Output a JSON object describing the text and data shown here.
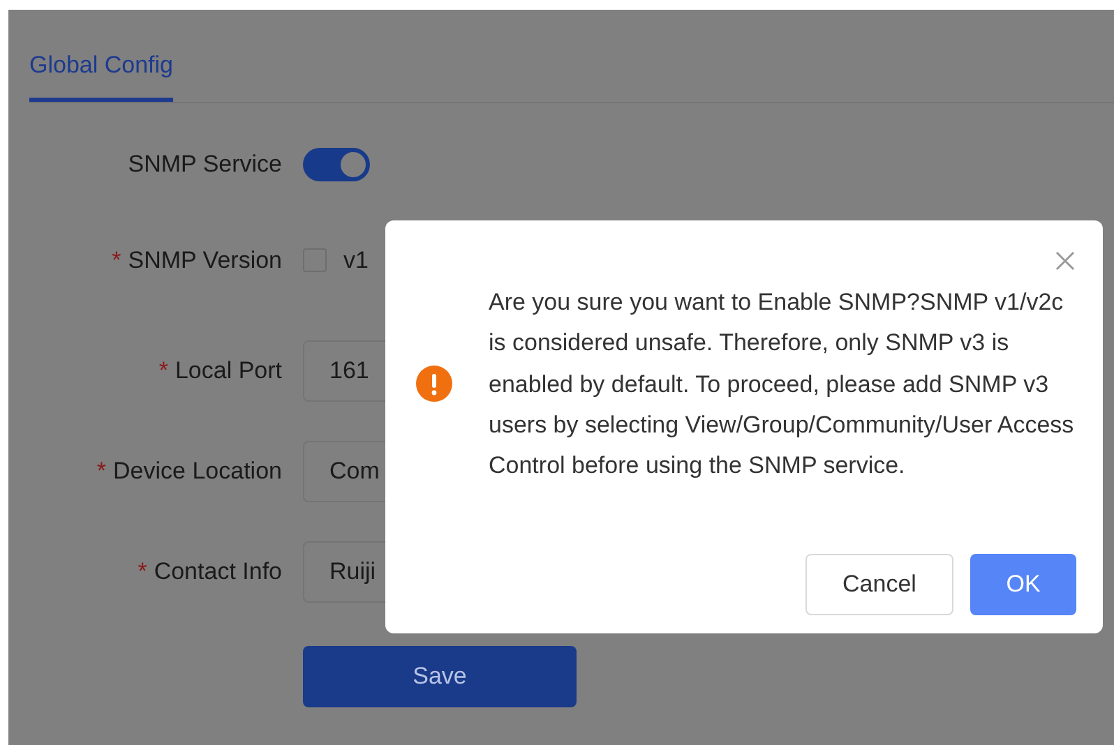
{
  "tabs": [
    {
      "label": "Global Config",
      "selected": true
    }
  ],
  "form": {
    "rows": [
      {
        "kind": "toggle",
        "label": "SNMP Service",
        "required": false,
        "on": true
      },
      {
        "kind": "checkbox",
        "label": "SNMP Version",
        "required": true,
        "option": "v1",
        "checked": false
      },
      {
        "kind": "input",
        "label": "Local Port",
        "required": true,
        "value": "161"
      },
      {
        "kind": "input",
        "label": "Device Location",
        "required": true,
        "value": "Com"
      },
      {
        "kind": "input",
        "label": "Contact Info",
        "required": true,
        "value": "Ruiji"
      }
    ],
    "required_mark": "*",
    "save_button": "Save"
  },
  "dialog": {
    "message": "Are you sure you want to Enable SNMP?SNMP v1/v2c is considered unsafe. Therefore, only SNMP v3 is enabled by default. To proceed, please add SNMP v3 users by selecting View/Group/Community/User Access Control before using the SNMP service.",
    "buttons": [
      {
        "label": "Cancel",
        "kind": "secondary"
      },
      {
        "label": "OK",
        "kind": "primary"
      }
    ]
  }
}
